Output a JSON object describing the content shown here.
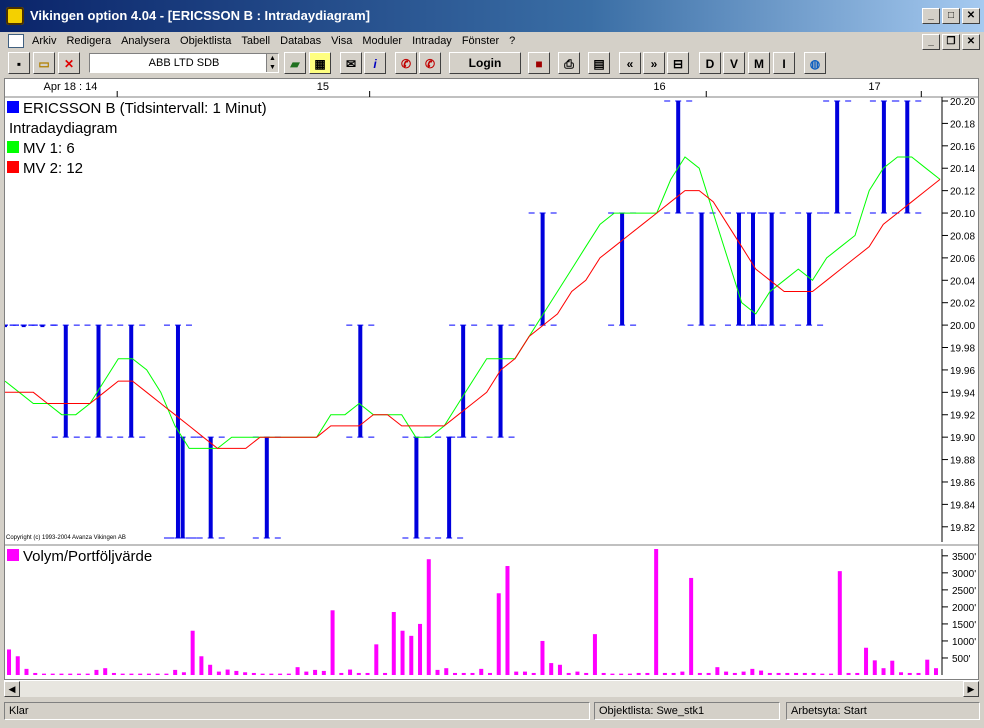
{
  "window": {
    "title": "Vikingen option 4.04 - [ERICSSON B : Intradaydiagram]"
  },
  "menu": [
    "Arkiv",
    "Redigera",
    "Analysera",
    "Objektlista",
    "Tabell",
    "Databas",
    "Visa",
    "Moduler",
    "Intraday",
    "Fönster",
    "?"
  ],
  "toolbar": {
    "symbol_value": "ABB LTD SDB",
    "login_label": "Login",
    "letters": [
      "D",
      "V",
      "M",
      "I"
    ]
  },
  "chart_data": {
    "type": "line",
    "title": "ERICSSON B (Tidsintervall: 1 Minut)",
    "subtitle": "Intradaydiagram",
    "legend": [
      {
        "name": "ERICSSON B (Tidsintervall: 1 Minut)",
        "color": "#0000ff"
      },
      {
        "name": "MV 1: 6",
        "color": "#00ff00"
      },
      {
        "name": "MV 2: 12",
        "color": "#ff0000"
      }
    ],
    "date_labels": [
      "Apr 18 : 14",
      "15",
      "16",
      "17"
    ],
    "y_ticks": [
      "20.20",
      "20.18",
      "20.16",
      "20.14",
      "20.12",
      "20.10",
      "20.08",
      "20.06",
      "20.04",
      "20.02",
      "20.00",
      "19.98",
      "19.96",
      "19.94",
      "19.92",
      "19.90",
      "19.88",
      "19.86",
      "19.84",
      "19.82"
    ],
    "ylim": [
      19.81,
      20.2
    ],
    "copyright": "Copyright (c) 1993-2004 Avanza Vikingen AB",
    "price_bars": [
      {
        "x": 0.0,
        "lo": 20.0,
        "hi": 20.0
      },
      {
        "x": 0.02,
        "lo": 20.0,
        "hi": 20.0
      },
      {
        "x": 0.04,
        "lo": 20.0,
        "hi": 20.0
      },
      {
        "x": 0.065,
        "lo": 19.9,
        "hi": 20.0
      },
      {
        "x": 0.1,
        "lo": 19.9,
        "hi": 20.0
      },
      {
        "x": 0.135,
        "lo": 19.9,
        "hi": 20.0
      },
      {
        "x": 0.185,
        "lo": 19.81,
        "hi": 20.0
      },
      {
        "x": 0.19,
        "lo": 19.81,
        "hi": 19.9
      },
      {
        "x": 0.22,
        "lo": 19.81,
        "hi": 19.9
      },
      {
        "x": 0.28,
        "lo": 19.81,
        "hi": 19.9
      },
      {
        "x": 0.38,
        "lo": 19.9,
        "hi": 20.0
      },
      {
        "x": 0.44,
        "lo": 19.81,
        "hi": 19.9
      },
      {
        "x": 0.475,
        "lo": 19.81,
        "hi": 19.9
      },
      {
        "x": 0.49,
        "lo": 19.9,
        "hi": 20.0
      },
      {
        "x": 0.53,
        "lo": 19.9,
        "hi": 20.0
      },
      {
        "x": 0.575,
        "lo": 20.0,
        "hi": 20.1
      },
      {
        "x": 0.66,
        "lo": 20.0,
        "hi": 20.1
      },
      {
        "x": 0.72,
        "lo": 20.1,
        "hi": 20.2
      },
      {
        "x": 0.745,
        "lo": 20.0,
        "hi": 20.1
      },
      {
        "x": 0.785,
        "lo": 20.0,
        "hi": 20.1
      },
      {
        "x": 0.8,
        "lo": 20.0,
        "hi": 20.1
      },
      {
        "x": 0.82,
        "lo": 20.0,
        "hi": 20.1
      },
      {
        "x": 0.86,
        "lo": 20.0,
        "hi": 20.1
      },
      {
        "x": 0.89,
        "lo": 20.1,
        "hi": 20.2
      },
      {
        "x": 0.94,
        "lo": 20.1,
        "hi": 20.2
      },
      {
        "x": 0.965,
        "lo": 20.1,
        "hi": 20.2
      }
    ],
    "series": [
      {
        "name": "MV 1: 6",
        "color": "#00ff00",
        "values": [
          19.95,
          19.94,
          19.93,
          19.93,
          19.92,
          19.92,
          19.93,
          19.95,
          19.97,
          19.97,
          19.96,
          19.94,
          19.91,
          19.89,
          19.89,
          19.89,
          19.9,
          19.9,
          19.9,
          19.9,
          19.9,
          19.9,
          19.9,
          19.92,
          19.92,
          19.93,
          19.92,
          19.92,
          19.92,
          19.9,
          19.9,
          19.91,
          19.93,
          19.95,
          19.97,
          19.97,
          19.97,
          19.99,
          20.01,
          20.03,
          20.05,
          20.07,
          20.09,
          20.1,
          20.1,
          20.1,
          20.1,
          20.13,
          20.15,
          20.14,
          20.1,
          20.06,
          20.02,
          20.01,
          20.03,
          20.04,
          20.05,
          20.04,
          20.06,
          20.07,
          20.08,
          20.12,
          20.14,
          20.15,
          20.15,
          20.14,
          20.13
        ]
      },
      {
        "name": "MV 2: 12",
        "color": "#ff0000",
        "values": [
          19.94,
          19.94,
          19.94,
          19.93,
          19.93,
          19.93,
          19.93,
          19.94,
          19.95,
          19.95,
          19.94,
          19.93,
          19.92,
          19.91,
          19.9,
          19.89,
          19.89,
          19.89,
          19.9,
          19.9,
          19.9,
          19.9,
          19.9,
          19.91,
          19.91,
          19.91,
          19.92,
          19.92,
          19.91,
          19.91,
          19.91,
          19.91,
          19.92,
          19.93,
          19.94,
          19.96,
          19.97,
          19.99,
          20.0,
          20.01,
          20.03,
          20.04,
          20.06,
          20.07,
          20.08,
          20.09,
          20.1,
          20.11,
          20.12,
          20.12,
          20.11,
          20.09,
          20.07,
          20.05,
          20.04,
          20.03,
          20.03,
          20.03,
          20.04,
          20.05,
          20.06,
          20.07,
          20.09,
          20.1,
          20.11,
          20.12,
          20.13
        ]
      }
    ]
  },
  "volume": {
    "title": "Volym/Portföljvärde",
    "color": "#ff00ff",
    "y_ticks": [
      "3500'",
      "3000'",
      "2500'",
      "2000'",
      "1500'",
      "1000'",
      "500'"
    ],
    "ymax": 3700,
    "values": [
      750,
      550,
      180,
      60,
      40,
      40,
      40,
      40,
      40,
      40,
      150,
      200,
      60,
      40,
      40,
      40,
      40,
      40,
      40,
      150,
      80,
      1300,
      550,
      300,
      100,
      160,
      120,
      80,
      60,
      40,
      40,
      40,
      40,
      230,
      100,
      150,
      120,
      1900,
      60,
      160,
      60,
      60,
      900,
      60,
      1850,
      1300,
      1150,
      1500,
      3400,
      150,
      200,
      60,
      60,
      60,
      180,
      60,
      2400,
      3200,
      100,
      100,
      60,
      1000,
      350,
      300,
      60,
      100,
      60,
      1200,
      60,
      40,
      40,
      40,
      60,
      60,
      3700,
      60,
      60,
      100,
      2850,
      60,
      60,
      230,
      100,
      60,
      100,
      180,
      130,
      60,
      60,
      60,
      60,
      60,
      60,
      40,
      40,
      3050,
      60,
      60,
      800,
      430,
      200,
      420,
      80,
      60,
      60,
      450,
      200
    ]
  },
  "status": {
    "left": "Klar",
    "objektlista": "Objektlista: Swe_stk1",
    "arbetsyta": "Arbetsyta: Start"
  }
}
